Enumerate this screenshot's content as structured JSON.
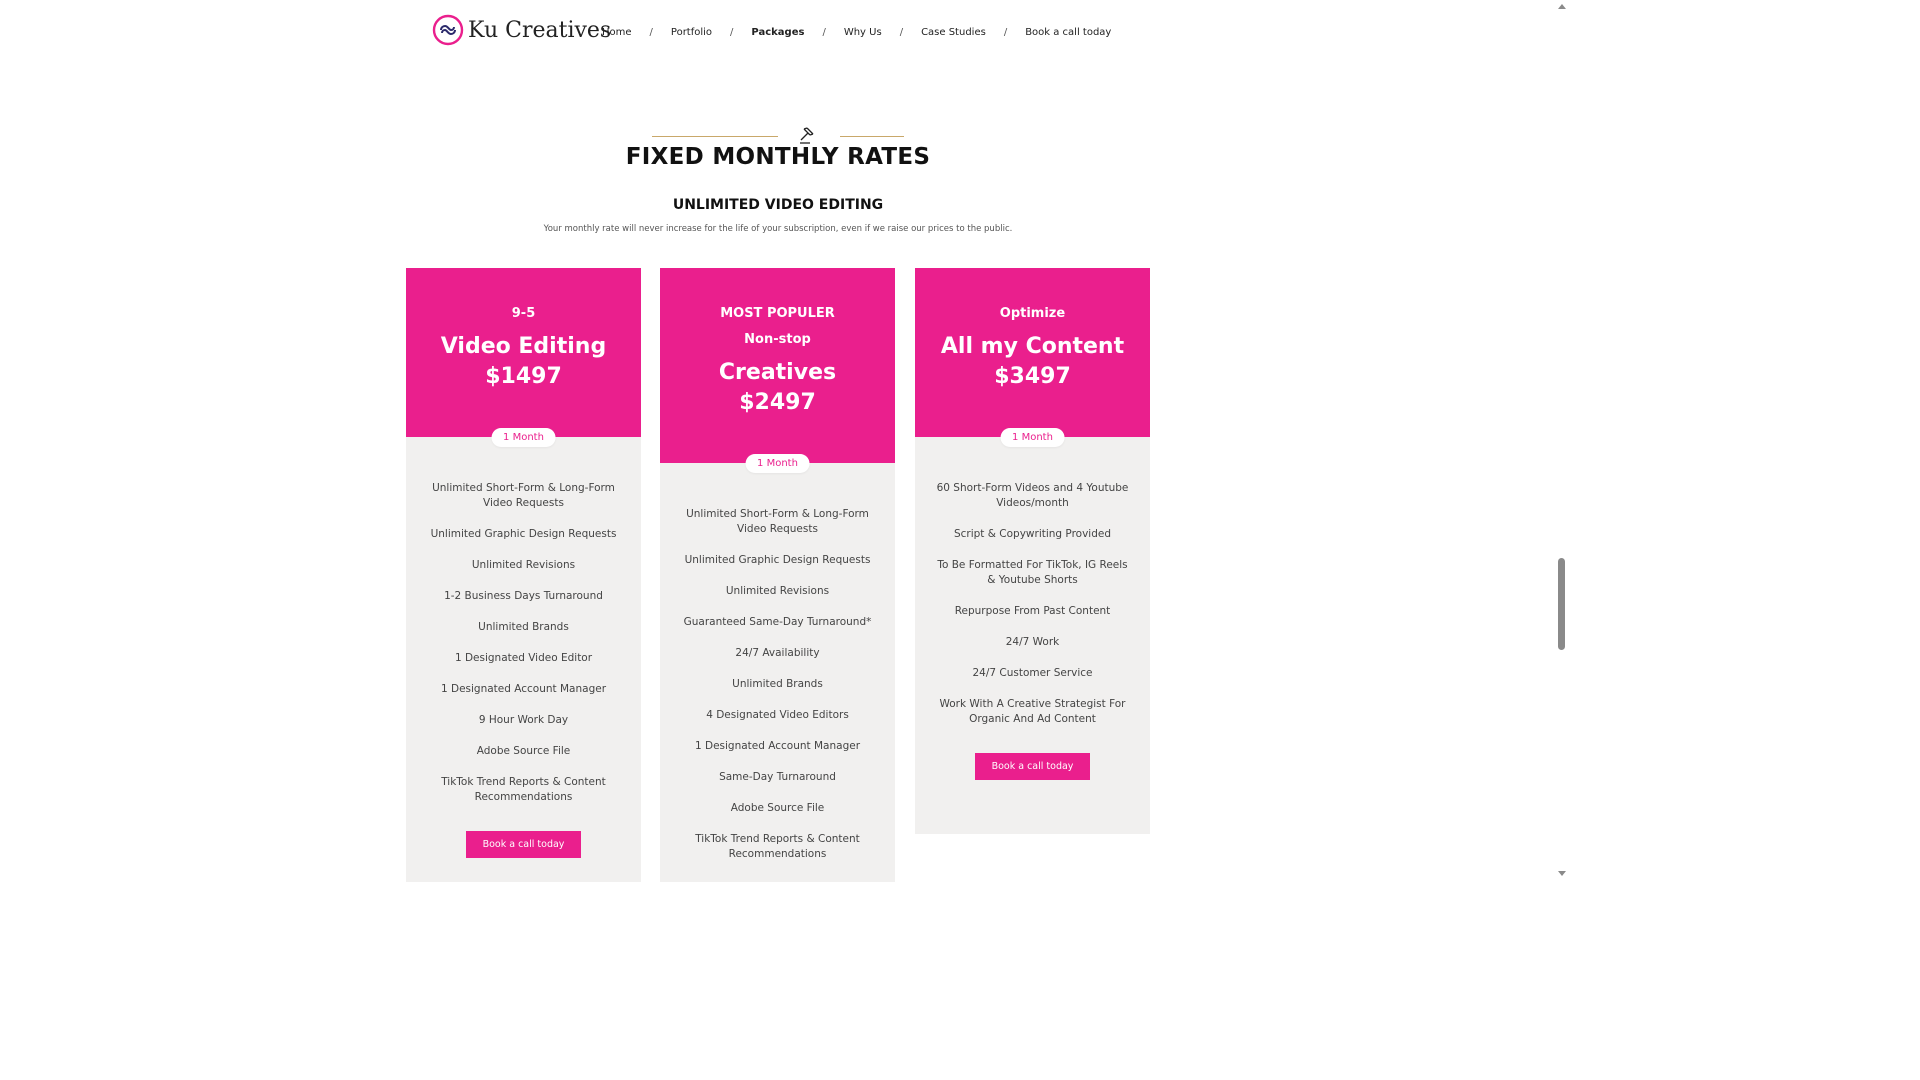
{
  "brand": {
    "name": "Ku Creatives",
    "accent": "#ea1f8d",
    "logo_icon": "infinity-logo-icon"
  },
  "nav": {
    "items": [
      {
        "label": "Home"
      },
      {
        "label": "Portfolio"
      },
      {
        "label": "Packages",
        "active": true
      },
      {
        "label": "Why Us"
      },
      {
        "label": "Case Studies"
      },
      {
        "label": "Book a call today"
      }
    ],
    "separator": "/"
  },
  "section": {
    "icon": "gavel-icon",
    "title": "FIXED MONTHLY RATES",
    "subtitle": "UNLIMITED VIDEO EDITING",
    "tagline": "Your monthly rate will never increase for the life of your subscription, even if we raise our prices to the public."
  },
  "plans": [
    {
      "tier": "9-5",
      "name": "Video Editing",
      "price": "$1497",
      "period": "1 Month",
      "features": [
        "Unlimited Short-Form & Long-Form Video Requests",
        "Unlimited Graphic Design Requests",
        "Unlimited Revisions",
        "1-2 Business Days Turnaround",
        "Unlimited Brands",
        "1 Designated Video Editor",
        "1 Designated Account Manager",
        "9 Hour Work Day",
        "Adobe Source File",
        "TikTok Trend Reports & Content Recommendations"
      ],
      "cta": "Book a call today"
    },
    {
      "tier": "MOST POPULER",
      "tier2": "Non-stop",
      "name": "Creatives",
      "price": "$2497",
      "period": "1 Month",
      "features": [
        "Unlimited Short-Form & Long-Form Video Requests",
        "Unlimited Graphic Design Requests",
        "Unlimited Revisions",
        "Guaranteed Same-Day Turnaround*",
        "24/7 Availability",
        "Unlimited Brands",
        "4 Designated Video Editors",
        "1 Designated Account Manager",
        "Same-Day Turnaround",
        "Adobe Source File",
        "TikTok Trend Reports & Content Recommendations"
      ]
    },
    {
      "tier": "Optimize",
      "name": "All my Content",
      "price": "$3497",
      "period": "1 Month",
      "features": [
        "60 Short-Form Videos and 4 Youtube Videos/month",
        "Script & Copywriting Provided",
        "To Be Formatted For TikTok, IG Reels & Youtube Shorts",
        "Repurpose From Past Content",
        "24/7 Work",
        "24/7 Customer Service",
        "Work With A Creative Strategist For Organic And Ad Content"
      ],
      "cta": "Book a call today"
    }
  ]
}
